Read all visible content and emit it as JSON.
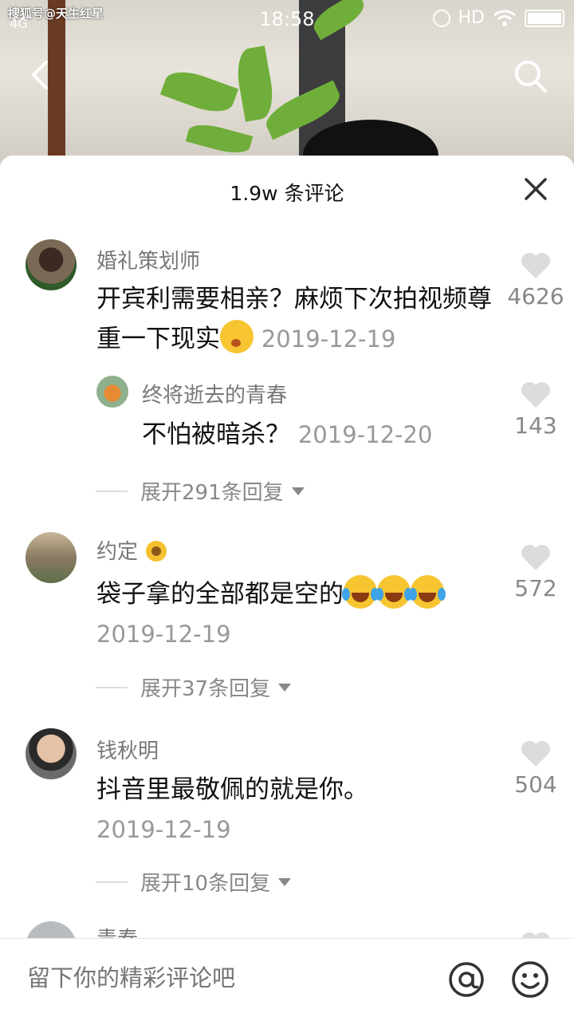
{
  "status_bar": {
    "watermark": "搜狐号@天生红星",
    "network": "4G",
    "time": "18:58",
    "hd": "HD"
  },
  "sheet": {
    "title": "1.9w 条评论"
  },
  "comments": [
    {
      "name": "婚礼策划师",
      "text": "开宾利需要相亲？麻烦下次拍视频尊重一下现实",
      "date": "2019-12-19",
      "likes": "4626",
      "reply": {
        "name": "终将逝去的青春",
        "text": "不怕被暗杀？",
        "date": "2019-12-20",
        "likes": "143"
      },
      "expand": "展开291条回复"
    },
    {
      "name": "约定",
      "text": "袋子拿的全部都是空的",
      "date": "2019-12-19",
      "likes": "572",
      "expand": "展开37条回复"
    },
    {
      "name": "钱秋明",
      "text": "抖音里最敬佩的就是你。",
      "date": "2019-12-19",
      "likes": "504",
      "expand": "展开10条回复"
    },
    {
      "name": "青春"
    }
  ],
  "bottom": {
    "placeholder": "留下你的精彩评论吧"
  },
  "colors": {
    "accent_gray": "#888888",
    "emoji_yellow": "#f7c531"
  }
}
